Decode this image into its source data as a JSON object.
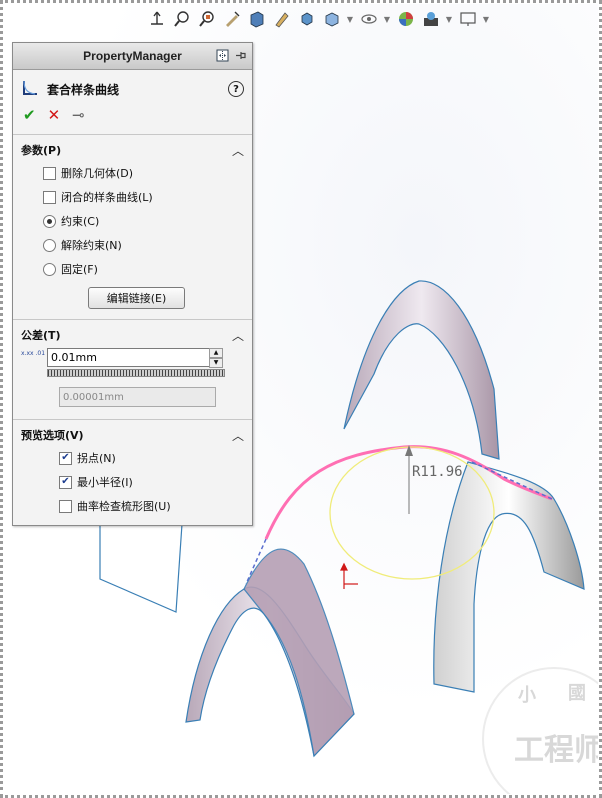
{
  "toolbar": {
    "icons": [
      "orient-icon",
      "zoom-fit-icon",
      "zoom-area-icon",
      "previous-view-icon",
      "section-view-icon",
      "dynamic-annotation-icon",
      "view-orientation-icon",
      "display-style-icon",
      "hide-show-icon",
      "edit-appearance-icon",
      "apply-scene-icon",
      "view-settings-icon"
    ]
  },
  "property_manager": {
    "header": "PropertyManager",
    "feature_title": "套合样条曲线",
    "help_label": "?",
    "params_section": {
      "title": "参数(P)",
      "delete_geometry": {
        "label": "删除几何体(D)",
        "checked": false
      },
      "closed_spline": {
        "label": "闭合的样条曲线(L)",
        "checked": false
      },
      "radio_constrained": {
        "label": "约束(C)",
        "selected": true
      },
      "radio_unconstrained": {
        "label": "解除约束(N)",
        "selected": false
      },
      "radio_fixed": {
        "label": "固定(F)",
        "selected": false
      },
      "edit_link_button": "编辑链接(E)"
    },
    "tolerance_section": {
      "title": "公差(T)",
      "icon_text": "x.xx .01",
      "value": "0.01mm",
      "readonly_value": "0.00001mm"
    },
    "preview_section": {
      "title": "预览选项(V)",
      "inflection": {
        "label": "拐点(N)",
        "checked": true
      },
      "min_radius": {
        "label": "最小半径(I)",
        "checked": true
      },
      "curvature_comb": {
        "label": "曲率检查梳形图(U)",
        "checked": false
      }
    }
  },
  "graphics": {
    "radius_dimension": "R11.96",
    "watermark_top": "小",
    "watermark_top2": "國",
    "watermark_text": "工程师"
  }
}
